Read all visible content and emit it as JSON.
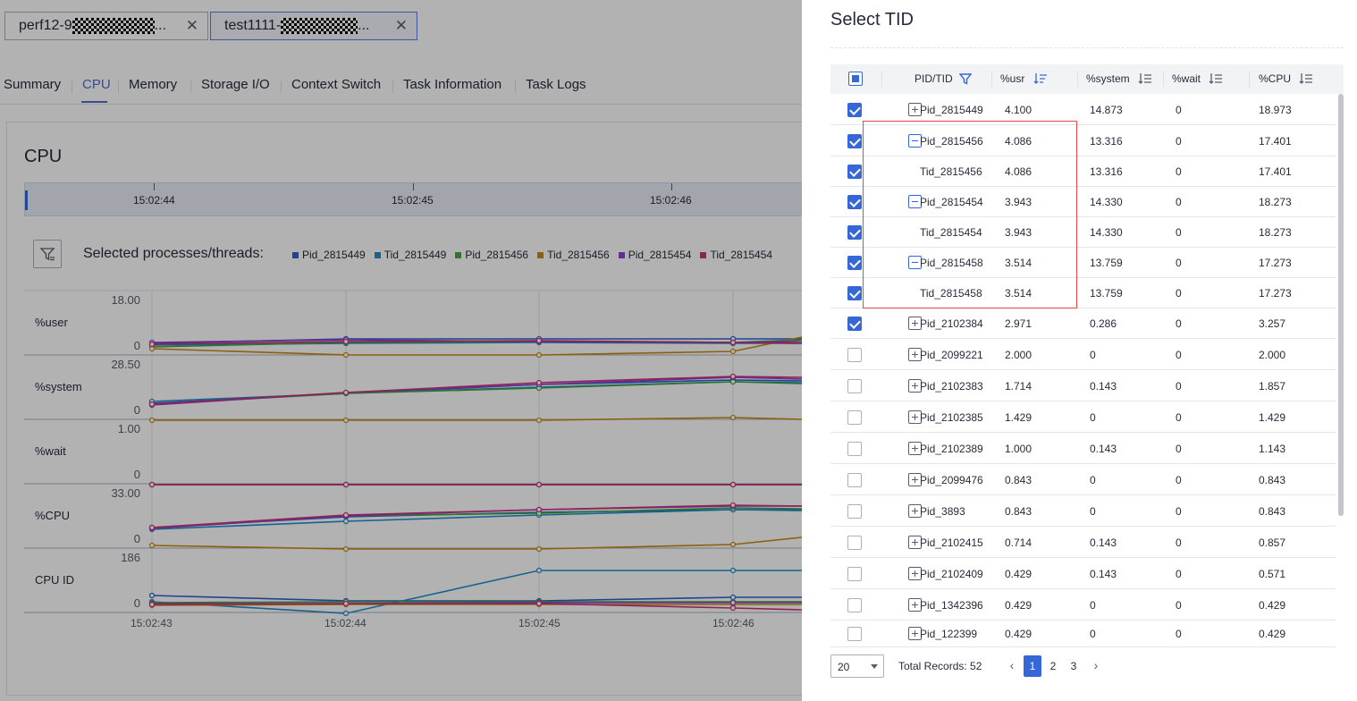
{
  "file_tabs": [
    {
      "label": "perf12-9",
      "suffix": "...",
      "active": false
    },
    {
      "label": "test1111-",
      "suffix": "...",
      "active": true
    }
  ],
  "subtabs": [
    "Summary",
    "CPU",
    "Memory",
    "Storage I/O",
    "Context Switch",
    "Task Information",
    "Task Logs"
  ],
  "active_subtab": "CPU",
  "section_title": "CPU",
  "timeline_labels": [
    "15:02:44",
    "15:02:45",
    "15:02:46"
  ],
  "legend_title": "Selected processes/threads:",
  "legend": [
    {
      "name": "Pid_2815449",
      "color": "#2f5fd6"
    },
    {
      "name": "Tid_2815449",
      "color": "#1f8fd0"
    },
    {
      "name": "Pid_2815456",
      "color": "#41a842"
    },
    {
      "name": "Tid_2815456",
      "color": "#c98a14"
    },
    {
      "name": "Pid_2815454",
      "color": "#8e44c9"
    },
    {
      "name": "Tid_2815454",
      "color": "#d0317c"
    }
  ],
  "chart_data": {
    "type": "line",
    "x": [
      "15:02:43",
      "15:02:44",
      "15:02:45",
      "15:02:46"
    ],
    "panels": [
      {
        "label": "%user",
        "max": "18.00",
        "min": "0"
      },
      {
        "label": "%system",
        "max": "28.50",
        "min": "0"
      },
      {
        "label": "%wait",
        "max": "1.00",
        "min": "0"
      },
      {
        "label": "%CPU",
        "max": "33.00",
        "min": "0"
      },
      {
        "label": "CPU ID",
        "max": "186",
        "min": "0"
      }
    ]
  },
  "drawer": {
    "title": "Select TID",
    "columns": [
      "PID/TID",
      "%usr",
      "%system",
      "%wait",
      "%CPU"
    ],
    "rows": [
      {
        "id": "Pid_2815449",
        "usr": "4.100",
        "system": "14.873",
        "wait": "0",
        "cpu": "18.973",
        "checked": true,
        "expand": "plus"
      },
      {
        "id": "Pid_2815456",
        "usr": "4.086",
        "system": "13.316",
        "wait": "0",
        "cpu": "17.401",
        "checked": true,
        "expand": "minus"
      },
      {
        "id": "Tid_2815456",
        "usr": "4.086",
        "system": "13.316",
        "wait": "0",
        "cpu": "17.401",
        "checked": true,
        "expand": "none"
      },
      {
        "id": "Pid_2815454",
        "usr": "3.943",
        "system": "14.330",
        "wait": "0",
        "cpu": "18.273",
        "checked": true,
        "expand": "minus"
      },
      {
        "id": "Tid_2815454",
        "usr": "3.943",
        "system": "14.330",
        "wait": "0",
        "cpu": "18.273",
        "checked": true,
        "expand": "none"
      },
      {
        "id": "Pid_2815458",
        "usr": "3.514",
        "system": "13.759",
        "wait": "0",
        "cpu": "17.273",
        "checked": true,
        "expand": "minus"
      },
      {
        "id": "Tid_2815458",
        "usr": "3.514",
        "system": "13.759",
        "wait": "0",
        "cpu": "17.273",
        "checked": true,
        "expand": "none"
      },
      {
        "id": "Pid_2102384",
        "usr": "2.971",
        "system": "0.286",
        "wait": "0",
        "cpu": "3.257",
        "checked": true,
        "expand": "plus"
      },
      {
        "id": "Pid_2099221",
        "usr": "2.000",
        "system": "0",
        "wait": "0",
        "cpu": "2.000",
        "checked": false,
        "expand": "plus"
      },
      {
        "id": "Pid_2102383",
        "usr": "1.714",
        "system": "0.143",
        "wait": "0",
        "cpu": "1.857",
        "checked": false,
        "expand": "plus"
      },
      {
        "id": "Pid_2102385",
        "usr": "1.429",
        "system": "0",
        "wait": "0",
        "cpu": "1.429",
        "checked": false,
        "expand": "plus"
      },
      {
        "id": "Pid_2102389",
        "usr": "1.000",
        "system": "0.143",
        "wait": "0",
        "cpu": "1.143",
        "checked": false,
        "expand": "plus"
      },
      {
        "id": "Pid_2099476",
        "usr": "0.843",
        "system": "0",
        "wait": "0",
        "cpu": "0.843",
        "checked": false,
        "expand": "plus"
      },
      {
        "id": "Pid_3893",
        "usr": "0.843",
        "system": "0",
        "wait": "0",
        "cpu": "0.843",
        "checked": false,
        "expand": "plus"
      },
      {
        "id": "Pid_2102415",
        "usr": "0.714",
        "system": "0.143",
        "wait": "0",
        "cpu": "0.857",
        "checked": false,
        "expand": "plus"
      },
      {
        "id": "Pid_2102409",
        "usr": "0.429",
        "system": "0.143",
        "wait": "0",
        "cpu": "0.571",
        "checked": false,
        "expand": "plus"
      },
      {
        "id": "Pid_1342396",
        "usr": "0.429",
        "system": "0",
        "wait": "0",
        "cpu": "0.429",
        "checked": false,
        "expand": "plus"
      },
      {
        "id": "Pid_122399",
        "usr": "0.429",
        "system": "0",
        "wait": "0",
        "cpu": "0.429",
        "checked": false,
        "expand": "plus"
      }
    ],
    "pager": {
      "page_size": "20",
      "total": "Total Records: 52",
      "pages": [
        "1",
        "2",
        "3"
      ],
      "current": "1"
    }
  }
}
